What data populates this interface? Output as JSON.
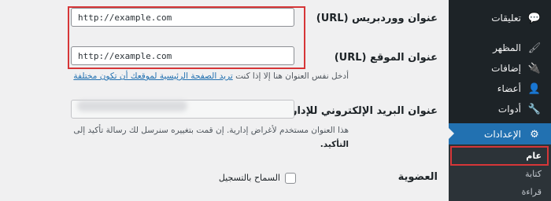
{
  "sidebar": {
    "items": [
      {
        "label": "تعليقات",
        "icon": "comments-icon",
        "glyph": "💬"
      },
      {
        "label": "المظهر",
        "icon": "appearance-brush-icon",
        "glyph": "🖌"
      },
      {
        "label": "إضافات",
        "icon": "plugins-icon",
        "glyph": "🔌"
      },
      {
        "label": "أعضاء",
        "icon": "users-icon",
        "glyph": "👤"
      },
      {
        "label": "أدوات",
        "icon": "tools-wrench-icon",
        "glyph": "🔧"
      },
      {
        "label": "الإعدادات",
        "icon": "settings-sliders-icon",
        "glyph": "⚙"
      }
    ],
    "submenu": [
      {
        "label": "عام"
      },
      {
        "label": "كتابة"
      },
      {
        "label": "قراءة"
      }
    ],
    "active_color": "#2271b1",
    "highlight_color": "#d63638"
  },
  "form": {
    "wp_url": {
      "label": "عنوان ووردبريس (URL)",
      "value": "http://example.com"
    },
    "site_url": {
      "label": "عنوان الموقع (URL)",
      "value": "http://example.com"
    },
    "site_url_desc_prefix": "أدخل نفس العنوان هنا إلا إذا كنت ",
    "site_url_desc_link": "تريد الصفحة الرئيسية لموقعك أن تكون مختلفة",
    "admin_email": {
      "label": "عنوان البريد الإلكتروني للإدارة"
    },
    "admin_email_desc_line1": "هذا العنوان مستخدم لأغراض إدارية. إن قمت بتغييره سنرسل لك رسالة تأكيد إلى",
    "admin_email_desc_line2": "التأكيد.",
    "membership": {
      "label": "العضوية",
      "checkbox_label": "السماح بالتسجيل"
    }
  }
}
